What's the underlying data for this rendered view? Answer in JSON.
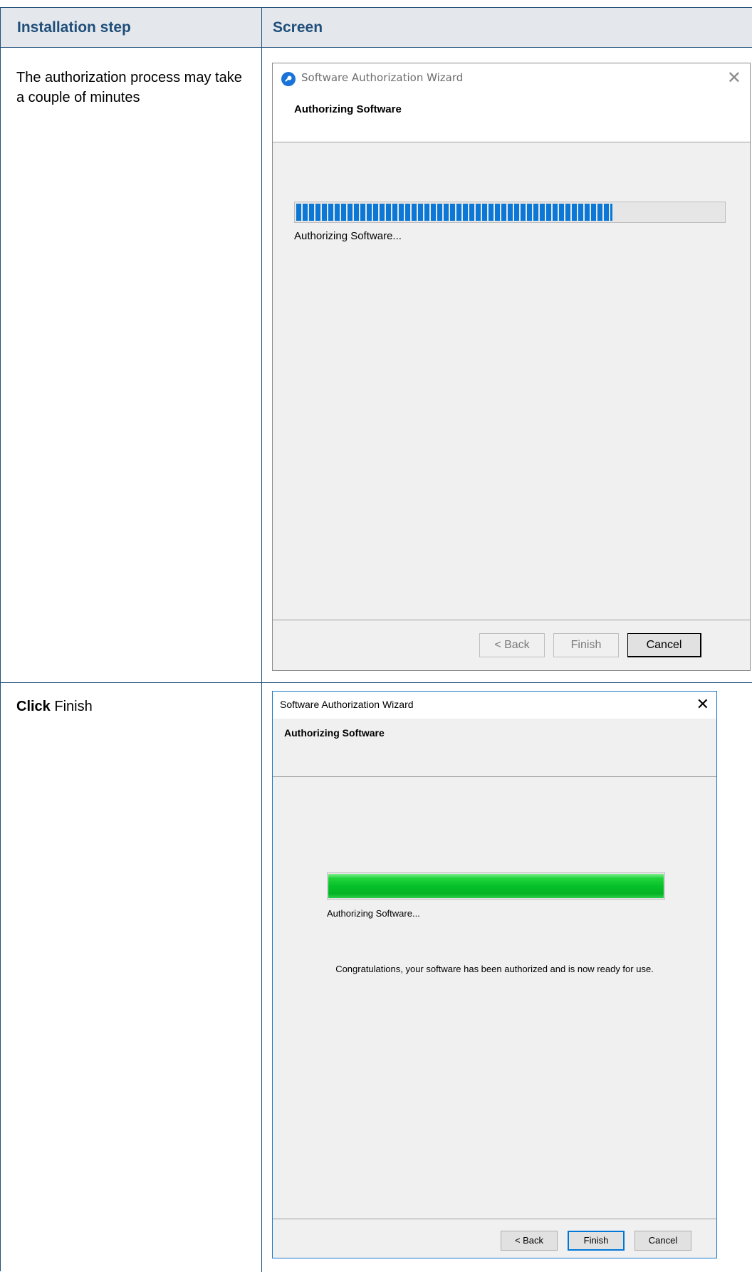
{
  "table": {
    "header_step": "Installation step",
    "header_screen": "Screen"
  },
  "rows": [
    {
      "step_text": "The authorization process may take a couple of minutes",
      "wizard": {
        "title": "Software Authorization Wizard",
        "banner_title": "Authorizing Software",
        "status_text": "Authorizing Software...",
        "progress_fraction": 0.74,
        "progress_color": "#0b78d7",
        "back_label": "< Back",
        "finish_label": "Finish",
        "cancel_label": "Cancel",
        "close_glyph": "✕"
      }
    },
    {
      "step_bold": "Click",
      "step_text": "Finish",
      "wizard": {
        "title": "Software Authorization Wizard",
        "banner_title": "Authorizing Software",
        "status_text": "Authorizing Software...",
        "progress_fraction": 1.0,
        "progress_color": "#06c12a",
        "congrats_text": "Congratulations, your software has been authorized and is now ready for use.",
        "back_label": "< Back",
        "finish_label": "Finish",
        "cancel_label": "Cancel",
        "close_glyph": "✕"
      }
    }
  ],
  "colors": {
    "table_border": "#1f4e79",
    "header_bg": "#e4e8ed",
    "header_text": "#1f4e79"
  }
}
